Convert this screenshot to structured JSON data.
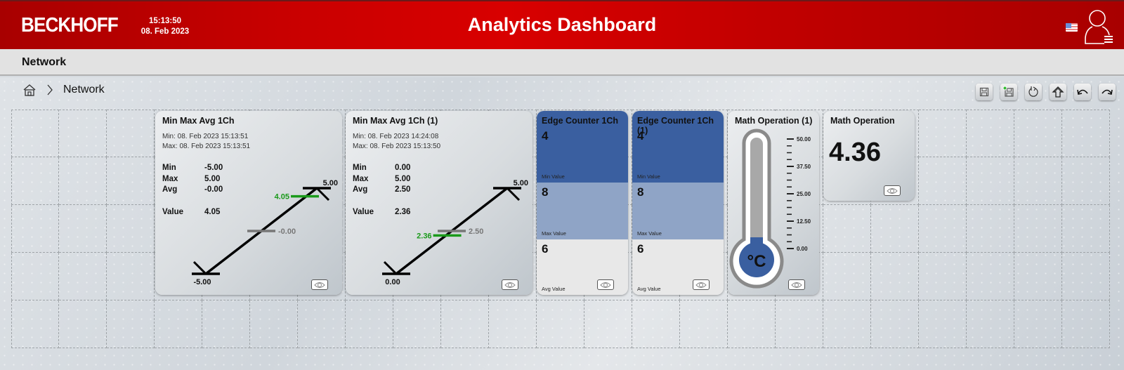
{
  "header": {
    "logo": "BECKHOFF",
    "time": "15:13:50",
    "date": "08. Feb 2023",
    "title": "Analytics Dashboard",
    "language_flag": "us-flag-icon",
    "user_icon": "user-icon"
  },
  "subbar": {
    "title": "Network"
  },
  "breadcrumb": {
    "home_icon": "home-icon",
    "separator": ">",
    "current": "Network"
  },
  "toolbar": [
    {
      "name": "save-button",
      "icon": "floppy-icon"
    },
    {
      "name": "save-as-button",
      "icon": "floppy-add-icon"
    },
    {
      "name": "reset-button",
      "icon": "reset-icon"
    },
    {
      "name": "upload-button",
      "icon": "upload-arrow-icon"
    },
    {
      "name": "undo-button",
      "icon": "undo-icon"
    },
    {
      "name": "redo-button",
      "icon": "redo-icon"
    }
  ],
  "tiles": {
    "minmax1": {
      "title": "Min Max Avg 1Ch",
      "min_ts": "Min:  08. Feb 2023 15:13:51",
      "max_ts": "Max: 08. Feb 2023 15:13:51",
      "labels": {
        "min": "Min",
        "max": "Max",
        "avg": "Avg",
        "value": "Value"
      },
      "min": "-5.00",
      "max": "5.00",
      "avg": "-0.00",
      "value": "4.05",
      "min_num": -5,
      "max_num": 5,
      "avg_num": 0,
      "value_num": 4.05
    },
    "minmax2": {
      "title": "Min Max Avg 1Ch (1)",
      "min_ts": "Min:  08. Feb 2023 14:24:08",
      "max_ts": "Max: 08. Feb 2023 15:13:50",
      "labels": {
        "min": "Min",
        "max": "Max",
        "avg": "Avg",
        "value": "Value"
      },
      "min": "0.00",
      "max": "5.00",
      "avg": "2.50",
      "value": "2.36",
      "min_num": 0,
      "max_num": 5,
      "avg_num": 2.5,
      "value_num": 2.36
    },
    "edge1": {
      "title": "Edge Counter 1Ch",
      "min_value": "4",
      "min_label": "Min Value",
      "max_value": "8",
      "max_label": "Max Value",
      "avg_value": "6",
      "avg_label": "Avg Value"
    },
    "edge2": {
      "title": "Edge Counter 1Ch (1)",
      "min_value": "4",
      "min_label": "Min Value",
      "max_value": "8",
      "max_label": "Max Value",
      "avg_value": "6",
      "avg_label": "Avg Value"
    },
    "thermo": {
      "title": "Math Operation (1)",
      "unit": "°C",
      "scale": [
        "50.00",
        "37.50",
        "25.00",
        "12.50",
        "0.00"
      ],
      "fill_fraction": 0.0
    },
    "math": {
      "title": "Math Operation",
      "value": "4.36"
    }
  },
  "colors": {
    "header_red": "#c80000",
    "edge_dark": "#3a5fa0",
    "edge_mid": "#8fa4c6",
    "edge_light": "#e8e8e8",
    "value_green": "#1a9a1a",
    "avg_gray": "#777777"
  }
}
